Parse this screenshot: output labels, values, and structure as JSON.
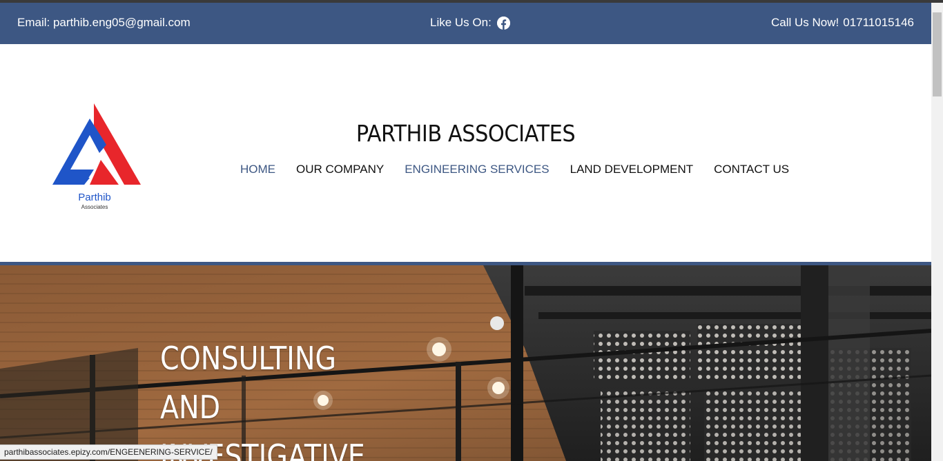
{
  "topbar": {
    "email_text": "Email: parthib.eng05@gmail.com",
    "like_label": "Like Us On:",
    "like_icon": "facebook-icon",
    "call_label": "Call Us Now!",
    "phone": "01711015146"
  },
  "header": {
    "logo_name": "Parthib",
    "logo_sub": "Associates",
    "site_title": "PARTHIB ASSOCIATES",
    "nav": [
      {
        "label": "HOME"
      },
      {
        "label": "OUR COMPANY"
      },
      {
        "label": "ENGINEERING SERVICES"
      },
      {
        "label": "LAND DEVELOPMENT"
      },
      {
        "label": "CONTACT US"
      }
    ]
  },
  "hero": {
    "lines": [
      "CONSULTING",
      "AND",
      "INVESTIGATIVE"
    ]
  },
  "status_url": "parthibassociates.epizy.com/ENGEENERING-SERVICE/",
  "colors": {
    "brand_blue": "#3d5783",
    "logo_red": "#e8262b",
    "logo_blue": "#1f55c8"
  }
}
